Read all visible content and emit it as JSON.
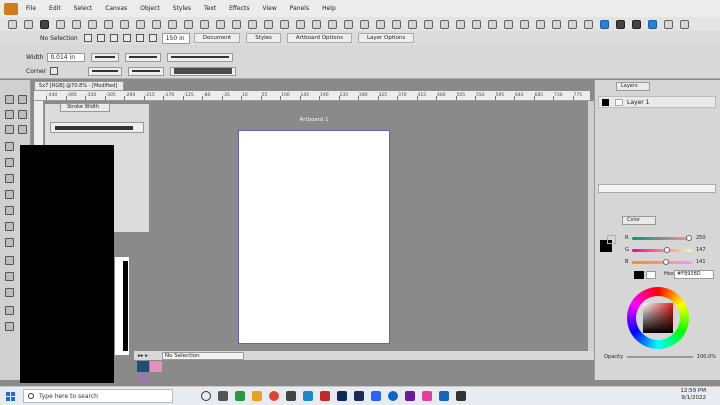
{
  "menu": {
    "items": [
      "File",
      "Edit",
      "Select",
      "Canvas",
      "Object",
      "Styles",
      "Text",
      "Effects",
      "View",
      "Panels",
      "Help"
    ]
  },
  "context_bar": {
    "selection": "No Selection",
    "zoom": "150 in",
    "document_button": "Document",
    "styles_button": "Styles",
    "artboard_options_button": "Artboard Options",
    "layer_options_button": "Layer Options"
  },
  "properties": {
    "width_label": "Width",
    "width_value": "0.014 in",
    "corner_label": "Corner"
  },
  "document_tab": "5x7 [RGB] @70.8% - [Modified]",
  "ruler_ticks": [
    "-440",
    "-395",
    "-350",
    "-305",
    "-260",
    "-215",
    "-170",
    "-125",
    "-80",
    "-35",
    "10",
    "55",
    "100",
    "145",
    "190",
    "235",
    "280",
    "325",
    "370",
    "415",
    "460",
    "505",
    "550",
    "595",
    "640",
    "685",
    "730",
    "775"
  ],
  "artboard": {
    "label": "Artboard 1"
  },
  "stroke_panel": {
    "tab": "Stroke Width"
  },
  "status": {
    "selection": "No Selection"
  },
  "layers_panel": {
    "tab": "Layers",
    "layer_name": "Layer 1"
  },
  "color_panel": {
    "tab": "Color",
    "r_label": "R",
    "g_label": "G",
    "b_label": "B",
    "r": "250",
    "g": "147",
    "b": "141",
    "hex_label": "Hex",
    "hex": "#F8938D",
    "opacity_label": "Opacity",
    "opacity": "100.0%",
    "colors": {
      "fill": "#000000",
      "sample": "#F8938D"
    }
  },
  "taskbar": {
    "search_placeholder": "Type here to search",
    "time": "12:59 PM",
    "date": "9/1/2022"
  },
  "colors": {
    "accent": "#2d7fd1",
    "artboard_border": "#6a5fb0",
    "canvas": "#8a8a8a"
  }
}
